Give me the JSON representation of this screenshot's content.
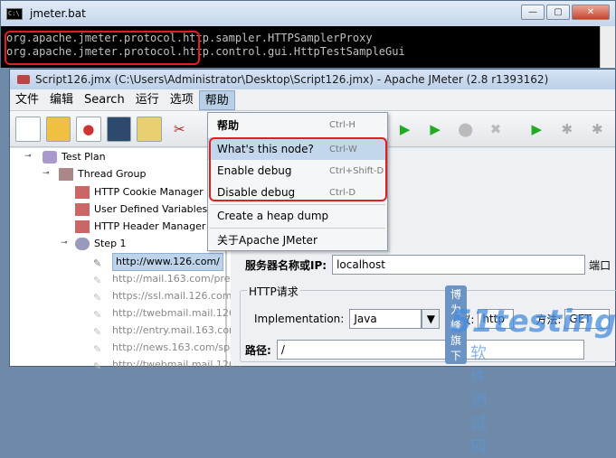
{
  "console": {
    "title": "jmeter.bat",
    "lines": [
      "org.apache.jmeter.protocol.http.sampler.HTTPSamplerProxy",
      "org.apache.jmeter.protocol.http.control.gui.HttpTestSampleGui"
    ]
  },
  "jmeter": {
    "title": "Script126.jmx (C:\\Users\\Administrator\\Desktop\\Script126.jmx) - Apache JMeter (2.8 r1393162)",
    "menus": [
      "文件",
      "编辑",
      "Search",
      "运行",
      "选项",
      "帮助"
    ],
    "help_menu": {
      "items": [
        {
          "label": "帮助",
          "accel": "Ctrl-H"
        },
        {
          "label": "What's this node?",
          "accel": "Ctrl-W"
        },
        {
          "label": "Enable debug",
          "accel": "Ctrl+Shift-D"
        },
        {
          "label": "Disable debug",
          "accel": "Ctrl-D"
        },
        {
          "label": "Create a heap dump",
          "accel": ""
        },
        {
          "label": "关于Apache JMeter",
          "accel": ""
        }
      ]
    },
    "tree": [
      "Test Plan",
      "Thread Group",
      "HTTP Cookie Manager",
      "User Defined Variables",
      "HTTP Header Manager",
      "Step 1",
      "http://www.126.com/",
      "http://mail.163.com/prelo",
      "https://ssl.mail.126.com/e",
      "http://twebmail.mail.126.c",
      "http://entry.mail.163.com",
      "http://news.163.com/spe",
      "http://twebmail.mail.126.c"
    ],
    "panel": {
      "server_label": "服务器名称或IP:",
      "server_value": "localhost",
      "port_label": "端口",
      "http_group": "HTTP请求",
      "impl_label": "Implementation:",
      "impl_value": "Java",
      "protocol_label": "协议:",
      "protocol_value": "http",
      "method_label": "方法:",
      "method_value": "GET",
      "path_label": "路径:",
      "path_value": "/"
    }
  },
  "watermark": {
    "top": "博为峰旗下",
    "brand": "51testing",
    "bottom": "软件测试网"
  },
  "colors": {
    "highlight_box": "#e02020",
    "selection": "#bcd3ea"
  }
}
